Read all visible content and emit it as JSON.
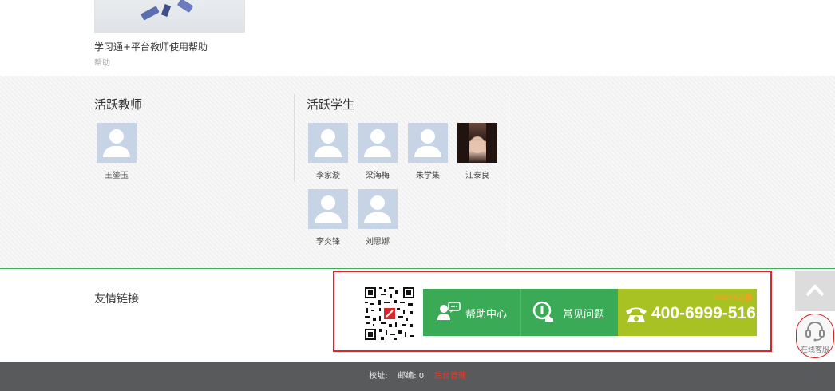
{
  "course": {
    "title": "学习通+平台教师使用帮助",
    "subtitle": "帮助"
  },
  "active_teachers": {
    "title": "活跃教师",
    "people": [
      {
        "name": "王鎏玉"
      }
    ]
  },
  "active_students": {
    "title": "活跃学生",
    "people": [
      {
        "name": "李家漩"
      },
      {
        "name": "梁海梅"
      },
      {
        "name": "朱学集"
      },
      {
        "name": "江泰良"
      },
      {
        "name": "李炎锋"
      },
      {
        "name": "刘思娜"
      }
    ]
  },
  "links": {
    "title": "友情链接",
    "help_center": "帮助中心",
    "faq": "常见问题",
    "phone": "400-6999-516",
    "brand": "FANYA泛雅"
  },
  "service": {
    "label": "在线客服"
  },
  "footer": {
    "address_label": "校址:",
    "postcode_label": "邮编:",
    "postcode_value": "0",
    "admin_link": "后台管理"
  },
  "colors": {
    "green": "#3aaa57",
    "olive": "#a9c223",
    "red_outline": "#d9272e",
    "footer_bg": "#595a5c"
  },
  "icons": [
    "help-center-icon",
    "faq-icon",
    "phone-icon",
    "arrow-up-icon",
    "headset-icon",
    "qr-code-icon"
  ]
}
